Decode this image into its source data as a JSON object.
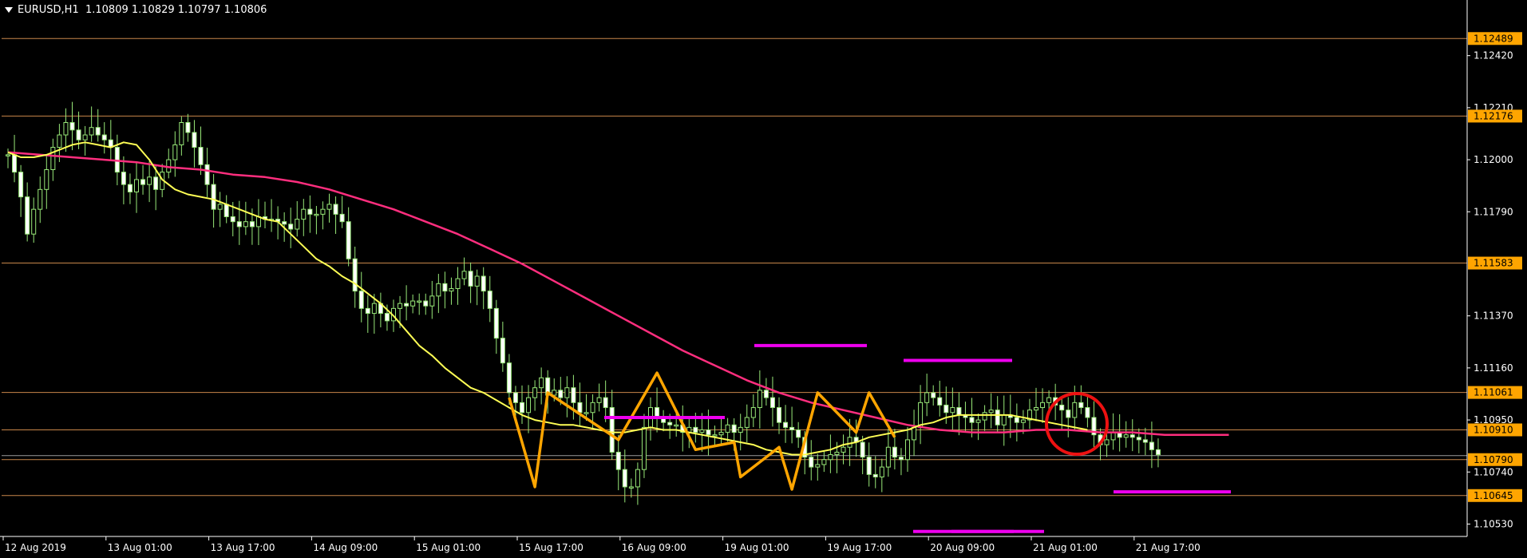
{
  "header": {
    "symbol": "EURUSD,H1",
    "ohlc": "1.10809 1.10829 1.10797 1.10806"
  },
  "colors": {
    "background": "#000000",
    "candle": "#98e878",
    "candle_body_bull": "#000000",
    "candle_body_bear": "#ffffff",
    "ma_fast": "#ffff55",
    "ma_slow": "#ff2e7e",
    "zigzag": "#ffa500",
    "level_line": "#c8864a",
    "level_label_bg": "#ffa500",
    "support_resistance": "#ee00ee",
    "circle": "#ee1111",
    "axis": "#ffffff"
  },
  "chart_data": {
    "type": "line",
    "title": "",
    "ylim": [
      1.1048,
      1.1258
    ],
    "x_tick_labels": [
      "12 Aug 2019",
      "13 Aug 01:00",
      "13 Aug 17:00",
      "14 Aug 09:00",
      "15 Aug 01:00",
      "15 Aug 17:00",
      "16 Aug 09:00",
      "19 Aug 01:00",
      "19 Aug 17:00",
      "20 Aug 09:00",
      "21 Aug 01:00",
      "21 Aug 17:00"
    ],
    "x_tick_index": [
      0,
      16,
      32,
      48,
      64,
      80,
      96,
      112,
      128,
      144,
      160,
      176
    ],
    "y_tick_labels": [
      "1.12420",
      "1.12210",
      "1.12000",
      "1.11790",
      "1.11370",
      "1.11160",
      "1.10950",
      "1.10740",
      "1.10530"
    ],
    "y_tick_values": [
      1.1242,
      1.1221,
      1.12,
      1.1179,
      1.1137,
      1.1116,
      1.1095,
      1.1074,
      1.1053
    ],
    "horizontal_levels": [
      {
        "label": "1.12489",
        "value": 1.12489
      },
      {
        "label": "1.12176",
        "value": 1.12176
      },
      {
        "label": "1.11583",
        "value": 1.11583
      },
      {
        "label": "1.11061",
        "value": 1.11061
      },
      {
        "label": "1.10910",
        "value": 1.1091
      },
      {
        "label": "1.10790",
        "value": 1.1079
      },
      {
        "label": "1.10645",
        "value": 1.10645
      }
    ],
    "current_price": 1.10806,
    "series": [
      {
        "key": "close",
        "values": [
          1.1202,
          1.1195,
          1.1185,
          1.117,
          1.118,
          1.1188,
          1.1196,
          1.1205,
          1.121,
          1.1215,
          1.1212,
          1.1208,
          1.121,
          1.1213,
          1.121,
          1.1208,
          1.1205,
          1.1195,
          1.119,
          1.1187,
          1.1192,
          1.119,
          1.1193,
          1.1188,
          1.1195,
          1.12,
          1.1206,
          1.1215,
          1.1211,
          1.1205,
          1.1198,
          1.119,
          1.118,
          1.1182,
          1.1177,
          1.1175,
          1.1173,
          1.1175,
          1.1173,
          1.1177,
          1.1176,
          1.1176,
          1.1175,
          1.1174,
          1.1172,
          1.1176,
          1.118,
          1.1178,
          1.1178,
          1.118,
          1.1182,
          1.1178,
          1.1175,
          1.116,
          1.1147,
          1.114,
          1.1138,
          1.1142,
          1.1138,
          1.1135,
          1.114,
          1.1142,
          1.1141,
          1.1143,
          1.1143,
          1.1141,
          1.1145,
          1.115,
          1.1147,
          1.1148,
          1.1152,
          1.1155,
          1.1149,
          1.1153,
          1.1147,
          1.114,
          1.1128,
          1.1118,
          1.1106,
          1.1102,
          1.1098,
          1.1104,
          1.1108,
          1.1112,
          1.1105,
          1.1107,
          1.1104,
          1.1108,
          1.1102,
          1.1098,
          1.1098,
          1.1102,
          1.1104,
          1.11,
          1.1082,
          1.1075,
          1.1068,
          1.1068,
          1.1075,
          1.1092,
          1.11,
          1.1096,
          1.1094,
          1.1093,
          1.1093,
          1.109,
          1.1092,
          1.109,
          1.1091,
          1.1089,
          1.1089,
          1.109,
          1.1093,
          1.109,
          1.1092,
          1.1096,
          1.11,
          1.1107,
          1.1104,
          1.11,
          1.1094,
          1.1092,
          1.1091,
          1.1088,
          1.108,
          1.1076,
          1.1077,
          1.1079,
          1.1081,
          1.1082,
          1.1084,
          1.1088,
          1.1086,
          1.108,
          1.1073,
          1.1072,
          1.1076,
          1.1084,
          1.108,
          1.1079,
          1.1087,
          1.1092,
          1.1102,
          1.1106,
          1.1104,
          1.1101,
          1.1098,
          1.11,
          1.1097,
          1.1096,
          1.1094,
          1.1095,
          1.1098,
          1.1099,
          1.1093,
          1.1097,
          1.1096,
          1.1094,
          1.1095,
          1.1099,
          1.11,
          1.1102,
          1.1104,
          1.1101,
          1.1099,
          1.1096,
          1.1102,
          1.11,
          1.1096,
          1.1089,
          1.1085,
          1.1087,
          1.109,
          1.1088,
          1.1089,
          1.1088,
          1.1087,
          1.1086,
          1.1083,
          1.1081
        ]
      },
      {
        "key": "ma_fast",
        "values": [
          1.1203,
          1.1201,
          1.1201,
          1.1202,
          1.1204,
          1.1206,
          1.1207,
          1.1206,
          1.1205,
          1.1207,
          1.1206,
          1.12,
          1.1192,
          1.1188,
          1.1186,
          1.1185,
          1.1184,
          1.1182,
          1.118,
          1.1178,
          1.1176,
          1.1175,
          1.117,
          1.1165,
          1.116,
          1.1157,
          1.1153,
          1.115,
          1.1146,
          1.1142,
          1.1137,
          1.1131,
          1.1125,
          1.1121,
          1.1116,
          1.1112,
          1.1108,
          1.1106,
          1.1103,
          1.11,
          1.1097,
          1.1095,
          1.1094,
          1.1093,
          1.1093,
          1.1092,
          1.1091,
          1.109,
          1.109,
          1.1091,
          1.1092,
          1.1091,
          1.1091,
          1.109,
          1.1089,
          1.1088,
          1.1087,
          1.1086,
          1.1085,
          1.1083,
          1.1082,
          1.1081,
          1.1081,
          1.1082,
          1.1083,
          1.1085,
          1.1086,
          1.1088,
          1.1089,
          1.109,
          1.1091,
          1.1093,
          1.1094,
          1.1096,
          1.1097,
          1.1097,
          1.1097,
          1.1097,
          1.1097,
          1.1096,
          1.1095,
          1.1094,
          1.1093,
          1.1092,
          1.1091
        ]
      },
      {
        "key": "ma_slow",
        "values": [
          1.1203,
          1.1202,
          1.1201,
          1.12,
          1.1199,
          1.1197,
          1.1196,
          1.1194,
          1.1193,
          1.1191,
          1.1188,
          1.1184,
          1.118,
          1.1175,
          1.117,
          1.1164,
          1.1158,
          1.1151,
          1.1144,
          1.1137,
          1.113,
          1.1123,
          1.1117,
          1.1111,
          1.1106,
          1.1102,
          1.1099,
          1.1096,
          1.1093,
          1.1091,
          1.109,
          1.109,
          1.1091,
          1.1091,
          1.109,
          1.109,
          1.1089,
          1.1089,
          1.1089
        ]
      },
      {
        "key": "zigzag",
        "values": [
          1.1104,
          1.1068,
          1.1106,
          1.1087,
          1.1114,
          1.1083,
          1.1086,
          1.1072,
          1.1084,
          1.1067,
          1.1106,
          1.109,
          1.1106,
          1.1088
        ]
      }
    ],
    "support_resistance_segments": [
      1.1096,
      1.1125,
      1.105,
      1.1119,
      1.105,
      1.1066
    ]
  }
}
